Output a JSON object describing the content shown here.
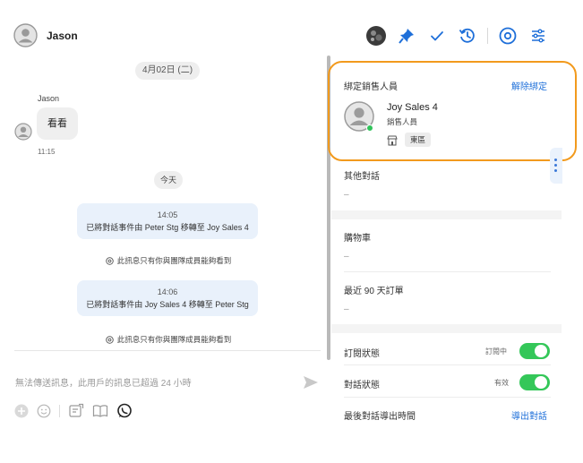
{
  "header": {
    "contact_name": "Jason",
    "icons": [
      "contact-avatar-icon",
      "photo-avatar-icon",
      "pin-icon",
      "checkmark-icon",
      "history-icon",
      "eye-icon",
      "sliders-icon"
    ]
  },
  "chat": {
    "date_label": "4月02日 (二)",
    "incoming": {
      "sender": "Jason",
      "text": "看看",
      "time": "11:15"
    },
    "today_label": "今天",
    "system_messages": [
      {
        "time": "14:05",
        "text": "已將對話事件由 Peter Stg 移轉至 Joy Sales 4",
        "note": "此訊息只有你與團隊成員能夠看到"
      },
      {
        "time": "14:06",
        "text": "已將對話事件由 Joy Sales 4 移轉至 Peter Stg",
        "note": "此訊息只有你與團隊成員能夠看到"
      }
    ],
    "composer_placeholder": "無法傳送訊息，此用戶的訊息已超過 24 小時"
  },
  "panel": {
    "bind_title": "綁定銷售人員",
    "unbind_label": "解除綁定",
    "sales": {
      "name": "Joy Sales 4",
      "role": "銷售人員",
      "store": "東區"
    },
    "other_conversations_label": "其他對話",
    "other_conversations_value": "–",
    "cart_label": "購物車",
    "cart_value": "–",
    "orders_label": "最近 90 天訂單",
    "orders_value": "–",
    "subscription_label": "訂閱狀態",
    "subscription_value": "訂閱中",
    "conversation_label": "對話狀態",
    "conversation_value": "有效",
    "export_time_label": "最後對話導出時間",
    "export_label": "導出對話"
  },
  "colors": {
    "accent_blue": "#1e6fd9",
    "highlight_orange": "#f29a1d",
    "toggle_green": "#34c759",
    "system_bubble": "#e9f1fb"
  }
}
